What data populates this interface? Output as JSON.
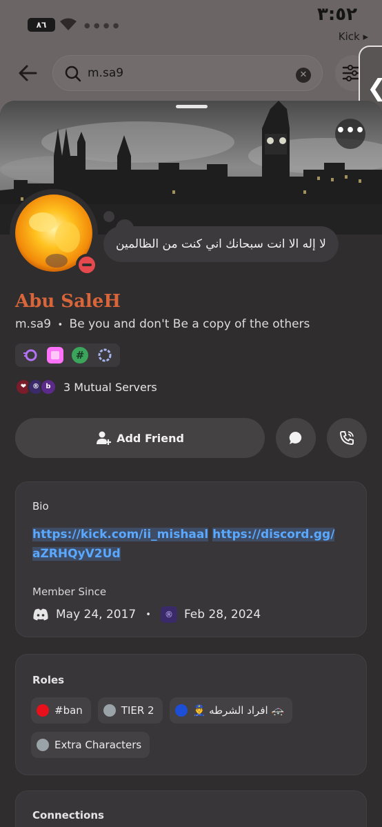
{
  "status_bar": {
    "battery": "٨٦",
    "clock": "٣:٥٢",
    "back_app": "Kick ▸"
  },
  "search": {
    "query": "m.sa9"
  },
  "profile": {
    "custom_status": "لا إله الا انت سبحانك اني كنت من الظالمين",
    "display_name": "Abu SaleH",
    "username": "m.sa9",
    "separator": "•",
    "tagline": "Be you and don't Be a copy of the others",
    "badges": [
      {
        "icon": "nitro-icon",
        "color": "#b473f5"
      },
      {
        "icon": "hypesquad-icon",
        "color": "#ff73fa"
      },
      {
        "icon": "hashtag-icon",
        "color": "#43b581"
      },
      {
        "icon": "server-boost-icon",
        "color": "#a8b6f0"
      }
    ],
    "mutual_servers": "3 Mutual Servers",
    "add_friend": "Add Friend"
  },
  "bio": {
    "title": "Bio",
    "link_1": "https://kick.com/ii_mishaal",
    "link_2": "https://discord.gg/",
    "link_3": "aZRHQyV2Ud",
    "member_since_label": "Member Since",
    "discord_date": "May 24, 2017",
    "dot": "•",
    "server_date": "Feb 28, 2024"
  },
  "roles": {
    "title": "Roles",
    "items": [
      {
        "label": "#ban",
        "color": "#e8101a"
      },
      {
        "label": "TIER 2",
        "color": "#99a3a8"
      },
      {
        "label": "👮 افراد الشرطه 🚓",
        "color": "#1c4fd6"
      },
      {
        "label": "Extra Characters",
        "color": "#99a3a8"
      }
    ]
  },
  "connections": {
    "title": "Connections"
  }
}
